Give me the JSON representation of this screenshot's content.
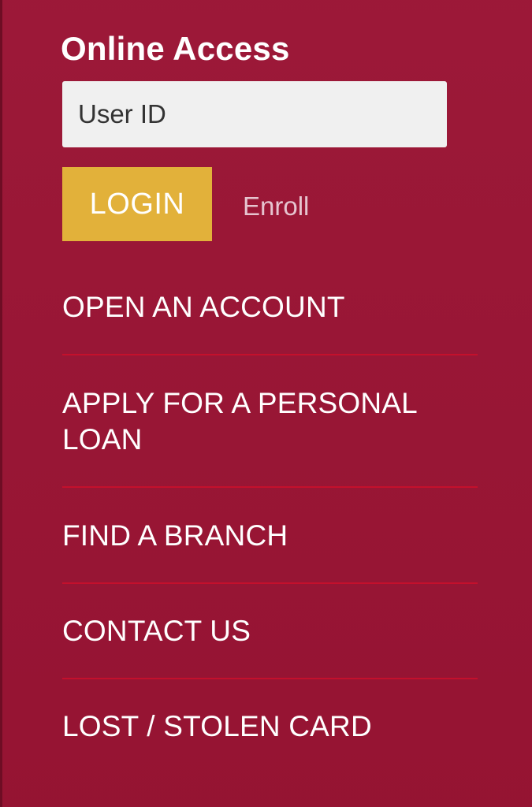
{
  "login": {
    "heading": "Online Access",
    "user_id_placeholder": "User ID",
    "login_label": "LOGIN",
    "enroll_label": "Enroll"
  },
  "nav": {
    "items": [
      {
        "label": "OPEN AN ACCOUNT"
      },
      {
        "label": "APPLY FOR A PERSONAL LOAN"
      },
      {
        "label": "FIND A BRANCH"
      },
      {
        "label": "CONTACT US"
      },
      {
        "label": "LOST / STOLEN CARD"
      }
    ]
  },
  "colors": {
    "background": "#9a1434",
    "login_button": "#e2b13a",
    "divider": "#c4102c",
    "input_background": "#f0f0f0"
  }
}
